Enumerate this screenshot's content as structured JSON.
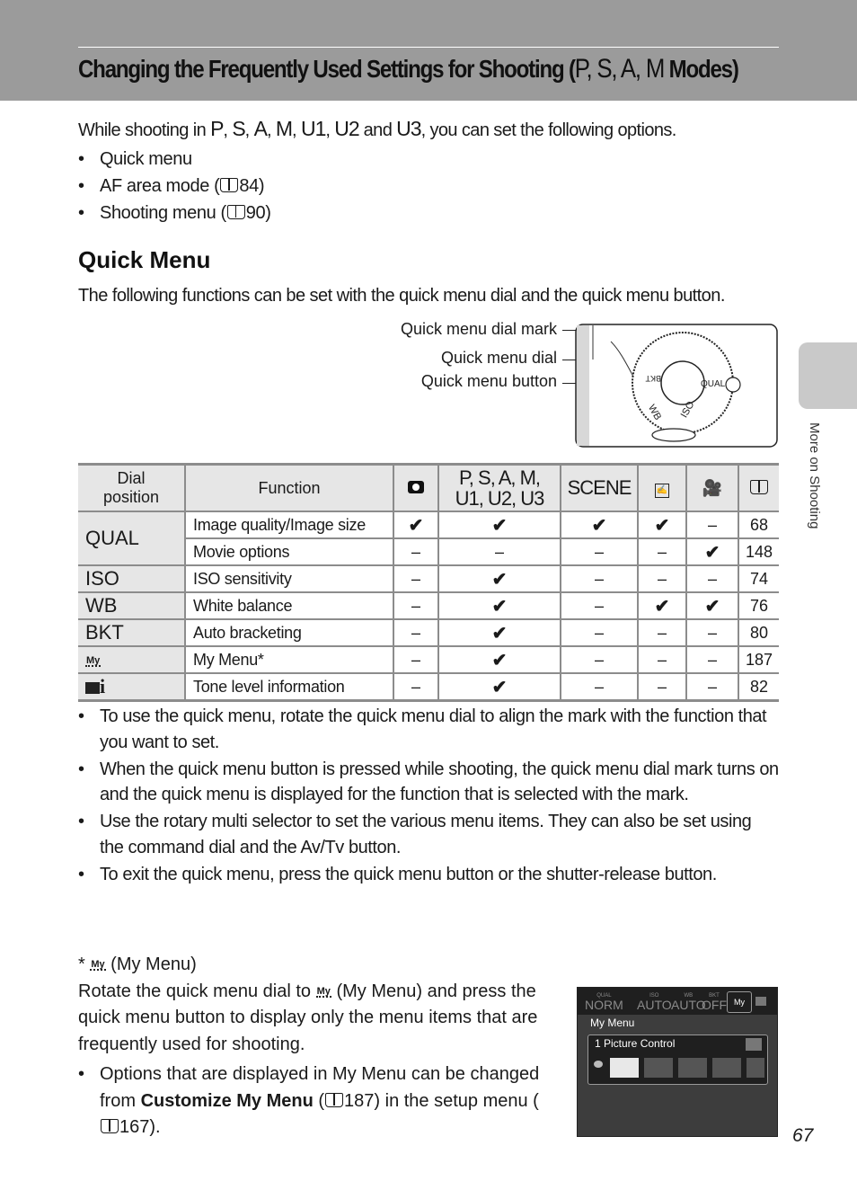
{
  "header": {
    "title": "Changing the Frequently Used Settings for Shooting (",
    "title_modes": "P, S, A, M",
    "title_end": " Modes)"
  },
  "intro": {
    "prefix": "While shooting in ",
    "modes": [
      "P",
      "S",
      "A",
      "M",
      "U1",
      "U2",
      "U3"
    ],
    "and": " and ",
    "suffix": ", you can set the following options."
  },
  "options": [
    {
      "text": "Quick menu",
      "ref": ""
    },
    {
      "text": "AF area mode (",
      "ref": "84",
      "end": ")"
    },
    {
      "text": "Shooting menu (",
      "ref": "90",
      "end": ")"
    }
  ],
  "section": {
    "title": "Quick Menu",
    "description": "The following functions can be set with the quick menu dial and the quick menu button."
  },
  "callouts": {
    "dial_mark": "Quick menu dial mark",
    "dial": "Quick menu dial",
    "button": "Quick menu button"
  },
  "diagram": {
    "dial_labels": [
      "QUAL",
      "ISO",
      "WB",
      "BKT"
    ]
  },
  "table": {
    "headers": [
      "Dial position",
      "Function",
      "camera-icon",
      "P, S, A, M, U1, U2, U3",
      "SCENE",
      "art-effects-icon",
      "movie-icon",
      "book-icon"
    ],
    "header_modes_line1": "P, S, A, M,",
    "header_modes_line2": "U1, U2, U3",
    "header_scene": "SCENE",
    "header_dial_line1": "Dial",
    "header_dial_line2": "position",
    "header_function": "Function",
    "check": "✔",
    "dash": "–",
    "rows": [
      {
        "dial": "QUAL",
        "function": "Image quality/Image size",
        "auto": "✔",
        "psam": "✔",
        "scene": "✔",
        "art": "✔",
        "movie": "–",
        "page": "68"
      },
      {
        "dial": "",
        "function": "Movie options",
        "auto": "–",
        "psam": "–",
        "scene": "–",
        "art": "–",
        "movie": "✔",
        "page": "148"
      },
      {
        "dial": "ISO",
        "function": "ISO sensitivity",
        "auto": "–",
        "psam": "✔",
        "scene": "–",
        "art": "–",
        "movie": "–",
        "page": "74"
      },
      {
        "dial": "WB",
        "function": "White balance",
        "auto": "–",
        "psam": "✔",
        "scene": "–",
        "art": "✔",
        "movie": "✔",
        "page": "76"
      },
      {
        "dial": "BKT",
        "function": "Auto bracketing",
        "auto": "–",
        "psam": "✔",
        "scene": "–",
        "art": "–",
        "movie": "–",
        "page": "80"
      },
      {
        "dial": "My",
        "function": "My Menu*",
        "auto": "–",
        "psam": "✔",
        "scene": "–",
        "art": "–",
        "movie": "–",
        "page": "187"
      },
      {
        "dial": "i",
        "function": "Tone level information",
        "auto": "–",
        "psam": "✔",
        "scene": "–",
        "art": "–",
        "movie": "–",
        "page": "82"
      }
    ]
  },
  "notes": [
    "To use the quick menu, rotate the quick menu dial to align the mark with the function that you want to set.",
    "When the quick menu button is pressed while shooting, the quick menu dial mark turns on and the quick menu is displayed for the function that is selected with the mark.",
    "Use the rotary multi selector to set the various menu items. They can also be set using the command dial and the Av/Tv button.",
    "To exit the quick menu, press the quick menu button or the shutter-release button."
  ],
  "my_menu": {
    "footnote_prefix": "* ",
    "footnote_label": " (My Menu)",
    "para_1": "Rotate the quick menu dial to ",
    "para_2": " (My Menu) and press the quick menu button to display only the menu items that are frequently used for shooting.",
    "bullet_1": "Options that are displayed in My Menu can be changed from ",
    "bullet_bold": "Customize My Menu",
    "bullet_2": " (",
    "bullet_ref1": "187",
    "bullet_3": ") in the setup menu (",
    "bullet_ref2": "167",
    "bullet_4": ")."
  },
  "screen": {
    "top_items": [
      {
        "small": "QUAL",
        "big": "NORM"
      },
      {
        "small": "ISO",
        "big": "AUTO"
      },
      {
        "small": "WB",
        "big": "AUTO"
      },
      {
        "small": "BKT",
        "big": "OFF"
      }
    ],
    "selected_icon": "My",
    "menu_label": "My Menu",
    "item": "1  Picture Control",
    "tiles": [
      "1",
      "2",
      "3",
      "4",
      "5"
    ]
  },
  "side_tab": {
    "label": "More on Shooting"
  },
  "page_number": "67"
}
